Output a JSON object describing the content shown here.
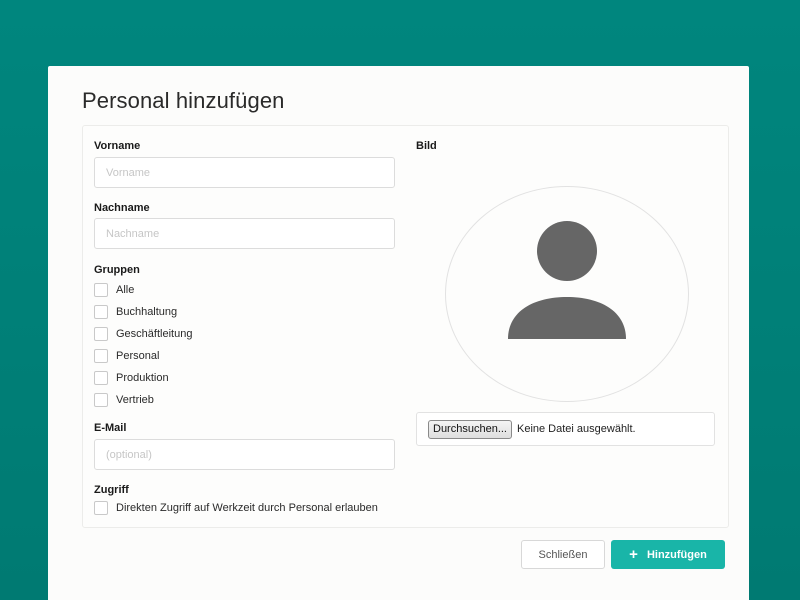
{
  "modal": {
    "title": "Personal hinzufügen"
  },
  "form": {
    "firstname": {
      "label": "Vorname",
      "value": "",
      "placeholder": "Vorname"
    },
    "lastname": {
      "label": "Nachname",
      "value": "",
      "placeholder": "Nachname"
    },
    "groups": {
      "label": "Gruppen",
      "items": [
        {
          "label": "Alle",
          "checked": false
        },
        {
          "label": "Buchhaltung",
          "checked": false
        },
        {
          "label": "Geschäftleitung",
          "checked": false
        },
        {
          "label": "Personal",
          "checked": false
        },
        {
          "label": "Produktion",
          "checked": false
        },
        {
          "label": "Vertrieb",
          "checked": false
        }
      ]
    },
    "email": {
      "label": "E-Mail",
      "value": "",
      "placeholder": "(optional)"
    },
    "access": {
      "label": "Zugriff",
      "option_label": "Direkten Zugriff auf Werkzeit durch Personal erlauben",
      "checked": false
    },
    "image": {
      "label": "Bild",
      "avatar_icon": "user-silhouette-icon",
      "browse_label": "Durchsuchen...",
      "file_status": "Keine Datei ausgewählt."
    }
  },
  "footer": {
    "close_label": "Schließen",
    "add_label": "Hinzufügen",
    "add_icon": "plus-icon"
  },
  "colors": {
    "background": "#00867e",
    "accent": "#19b5a8",
    "avatar_fill": "#666666"
  }
}
